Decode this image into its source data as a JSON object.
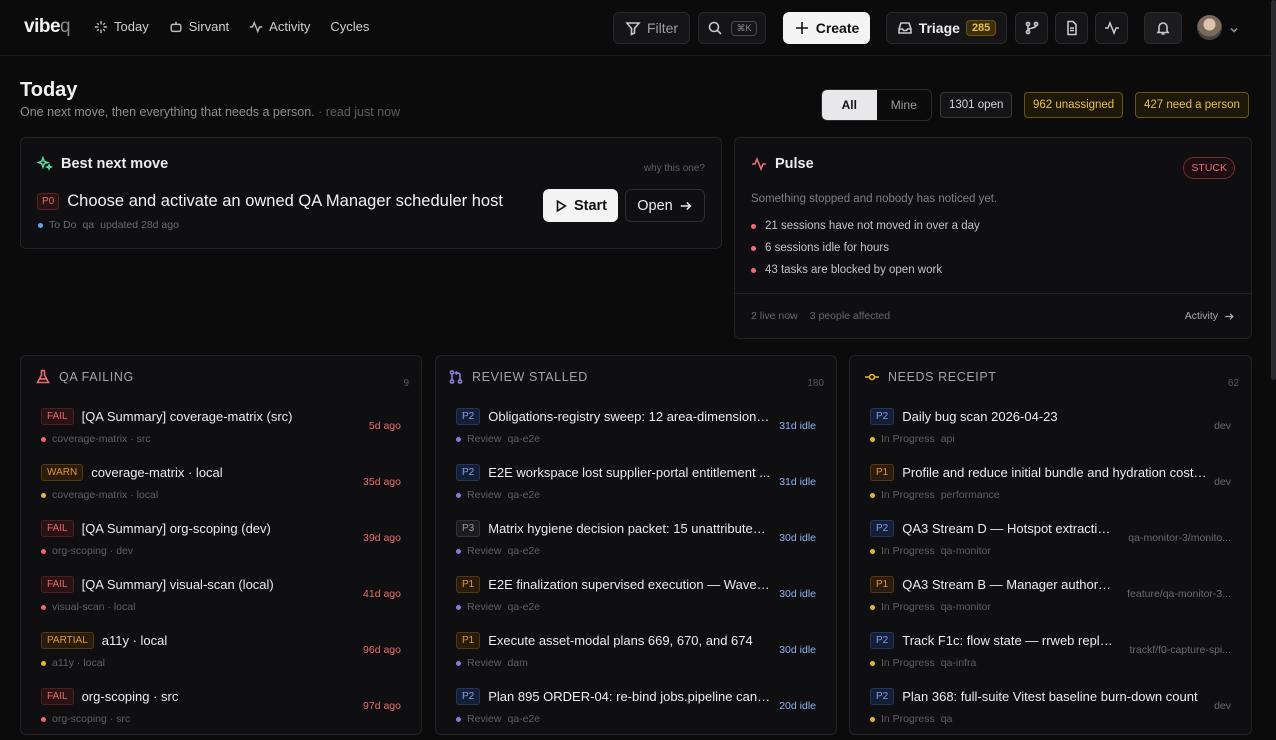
{
  "app": {
    "logo_main": "vibe",
    "logo_q": "q"
  },
  "nav": [
    {
      "label": "Today",
      "icon": "sparkle-icon"
    },
    {
      "label": "Sirvant",
      "icon": "robot-icon"
    },
    {
      "label": "Activity",
      "icon": "activity-icon"
    },
    {
      "label": "Cycles",
      "icon": ""
    }
  ],
  "toolbar": {
    "filter_label": "Filter",
    "search_kbd": "⌘K",
    "create_label": "Create",
    "triage_label": "Triage",
    "triage_count": "285"
  },
  "page": {
    "title": "Today",
    "subtitle": "One next move, then everything that needs a person.",
    "read_status": "· read just now",
    "scope_all": "All",
    "scope_mine": "Mine",
    "stat_open": "1301 open",
    "stat_unassigned": "962 unassigned",
    "stat_need_person": "427 need a person"
  },
  "best_move": {
    "heading": "Best next move",
    "why": "why this one?",
    "priority": "P0",
    "title": "Choose and activate an owned QA Manager scheduler host",
    "status": "To Do",
    "project": "qa",
    "updated": "updated 28d ago",
    "start_label": "Start",
    "open_label": "Open"
  },
  "pulse": {
    "heading": "Pulse",
    "badge": "STUCK",
    "desc": "Something stopped and nobody has noticed yet.",
    "items": [
      "21 sessions have not moved in over a day",
      "6 sessions idle for hours",
      "43 tasks are blocked by open work"
    ],
    "live": "2 live now",
    "affected": "3 people affected",
    "activity_link": "Activity"
  },
  "columns": [
    {
      "heading": "QA FAILING",
      "count": "9",
      "rows": [
        {
          "tag": "FAIL",
          "title": "[QA Summary] coverage-matrix (src)",
          "meta": "coverage-matrix · src",
          "age": "5d ago"
        },
        {
          "tag": "WARN",
          "title": "coverage-matrix · local",
          "meta": "coverage-matrix · local",
          "age": "35d ago"
        },
        {
          "tag": "FAIL",
          "title": "[QA Summary] org-scoping (dev)",
          "meta": "org-scoping · dev",
          "age": "39d ago"
        },
        {
          "tag": "FAIL",
          "title": "[QA Summary] visual-scan (local)",
          "meta": "visual-scan · local",
          "age": "41d ago"
        },
        {
          "tag": "PARTIAL",
          "title": "a11y · local",
          "meta": "a11y · local",
          "age": "96d ago"
        },
        {
          "tag": "FAIL",
          "title": "org-scoping · src",
          "meta": "org-scoping · src",
          "age": "97d ago"
        }
      ]
    },
    {
      "heading": "REVIEW STALLED",
      "count": "180",
      "rows": [
        {
          "tag": "P2",
          "title": "Obligations-registry sweep: 12 area-dimension ...",
          "status": "Review",
          "project": "qa-e2e",
          "age": "31d idle"
        },
        {
          "tag": "P2",
          "title": "E2E workspace lost supplier-portal entitlement ...",
          "status": "Review",
          "project": "qa-e2e",
          "age": "31d idle"
        },
        {
          "tag": "P3",
          "title": "Matrix hygiene decision packet: 15 unattributed...",
          "status": "Review",
          "project": "qa-e2e",
          "age": "30d idle"
        },
        {
          "tag": "P1",
          "title": "E2E finalization supervised execution — Waves ...",
          "status": "Review",
          "project": "qa-e2e",
          "age": "30d idle"
        },
        {
          "tag": "P1",
          "title": "Execute asset-modal plans 669, 670, and 674",
          "status": "Review",
          "project": "dam",
          "age": "30d idle"
        },
        {
          "tag": "P2",
          "title": "Plan 895 ORDER-04: re-bind jobs.pipeline canc...",
          "status": "Review",
          "project": "qa-e2e",
          "age": "20d idle"
        }
      ]
    },
    {
      "heading": "NEEDS RECEIPT",
      "count": "62",
      "rows": [
        {
          "tag": "P2",
          "title": "Daily bug scan 2026-04-23",
          "status": "In Progress",
          "project": "api",
          "age": "dev"
        },
        {
          "tag": "P1",
          "title": "Profile and reduce initial bundle and hydration cost ...",
          "status": "In Progress",
          "project": "performance",
          "age": "dev"
        },
        {
          "tag": "P2",
          "title": "QA3 Stream D — Hotspot extractio...",
          "status": "In Progress",
          "project": "qa-monitor",
          "age": "qa-monitor-3/monito..."
        },
        {
          "tag": "P1",
          "title": "QA3 Stream B — Manager authorit...",
          "status": "In Progress",
          "project": "qa-monitor",
          "age": "feature/qa-monitor-3..."
        },
        {
          "tag": "P2",
          "title": "Track F1c: flow state — rrweb repla...",
          "status": "In Progress",
          "project": "qa-infra",
          "age": "trackf/f0-capture-spi..."
        },
        {
          "tag": "P2",
          "title": "Plan 368: full-suite Vitest baseline burn-down count",
          "status": "In Progress",
          "project": "qa",
          "age": "dev"
        }
      ]
    }
  ],
  "colors": {
    "fail": "#ea6d6d",
    "warn": "#e0963f",
    "review_dot": "#8b7ae0",
    "inprogress_dot": "#e5b73b",
    "idle": "#8fb0f2"
  }
}
